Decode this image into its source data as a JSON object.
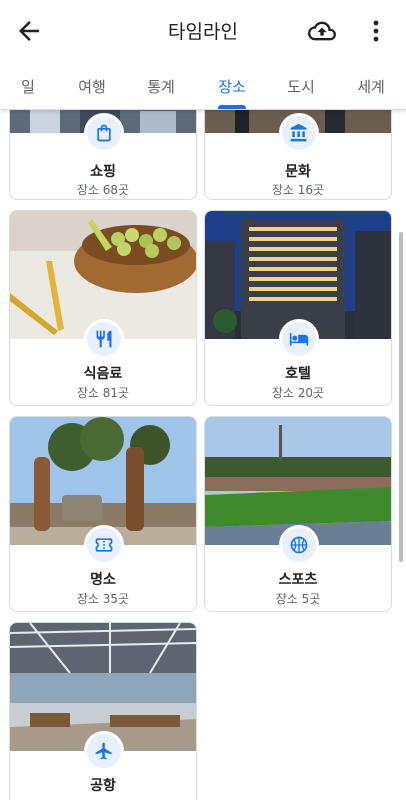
{
  "header": {
    "title": "타임라인",
    "back_icon": "arrow-back-icon",
    "upload_icon": "cloud-upload-icon",
    "more_icon": "more-vert-icon"
  },
  "tabs": [
    {
      "label": "일",
      "active": false
    },
    {
      "label": "여행",
      "active": false
    },
    {
      "label": "통계",
      "active": false
    },
    {
      "label": "장소",
      "active": true
    },
    {
      "label": "도시",
      "active": false
    },
    {
      "label": "세계",
      "active": false
    }
  ],
  "categories": [
    {
      "name": "쇼핑",
      "count": "장소 68곳",
      "icon": "shopping-bag-icon"
    },
    {
      "name": "문화",
      "count": "장소 16곳",
      "icon": "museum-icon"
    },
    {
      "name": "식음료",
      "count": "장소 81곳",
      "icon": "restaurant-icon"
    },
    {
      "name": "호텔",
      "count": "장소 20곳",
      "icon": "hotel-bed-icon"
    },
    {
      "name": "명소",
      "count": "장소 35곳",
      "icon": "ticket-icon"
    },
    {
      "name": "스포츠",
      "count": "장소 5곳",
      "icon": "basketball-icon"
    },
    {
      "name": "공항",
      "count": "",
      "icon": "airplane-icon"
    }
  ],
  "colors": {
    "accent": "#1a73e8",
    "icon_background": "#e8f0fe"
  }
}
